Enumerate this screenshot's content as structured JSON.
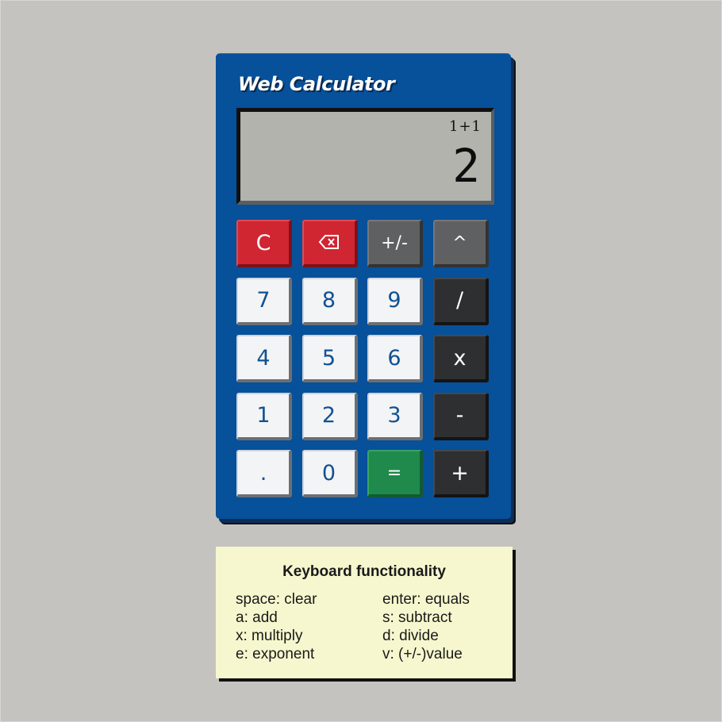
{
  "calculator": {
    "brand": "Web Calculator",
    "display": {
      "expression": "1+1",
      "result": "2"
    },
    "keys": [
      {
        "id": "clear",
        "label": "C",
        "style": "red"
      },
      {
        "id": "backspace",
        "label": "⌫",
        "style": "red",
        "icon": "backspace-icon"
      },
      {
        "id": "negate",
        "label": "+/-",
        "style": "gray"
      },
      {
        "id": "exponent",
        "label": "^",
        "style": "gray"
      },
      {
        "id": "7",
        "label": "7",
        "style": "num"
      },
      {
        "id": "8",
        "label": "8",
        "style": "num"
      },
      {
        "id": "9",
        "label": "9",
        "style": "num"
      },
      {
        "id": "divide",
        "label": "/",
        "style": "dark"
      },
      {
        "id": "4",
        "label": "4",
        "style": "num"
      },
      {
        "id": "5",
        "label": "5",
        "style": "num"
      },
      {
        "id": "6",
        "label": "6",
        "style": "num"
      },
      {
        "id": "multiply",
        "label": "x",
        "style": "dark"
      },
      {
        "id": "1",
        "label": "1",
        "style": "num"
      },
      {
        "id": "2",
        "label": "2",
        "style": "num"
      },
      {
        "id": "3",
        "label": "3",
        "style": "num"
      },
      {
        "id": "subtract",
        "label": "-",
        "style": "dark"
      },
      {
        "id": "decimal",
        "label": ".",
        "style": "num"
      },
      {
        "id": "0",
        "label": "0",
        "style": "num"
      },
      {
        "id": "equals",
        "label": "=",
        "style": "green"
      },
      {
        "id": "add",
        "label": "+",
        "style": "dark"
      }
    ],
    "colors": {
      "body": "#07509a",
      "display": "#b1b3ac",
      "clear_keys": "#d02632",
      "equals_key": "#1f8a4c",
      "operator_keys": "#2e2f31",
      "number_text": "#0f5292"
    }
  },
  "help": {
    "title": "Keyboard functionality",
    "items": [
      "space: clear",
      "enter: equals",
      "a: add",
      "s: subtract",
      "x: multiply",
      "d: divide",
      "e: exponent",
      "v: (+/-)value"
    ]
  }
}
